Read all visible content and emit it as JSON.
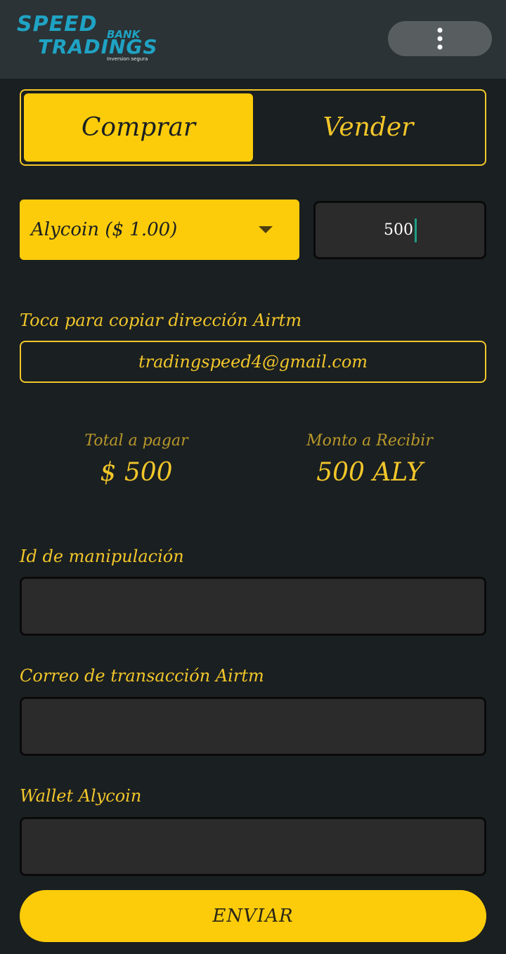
{
  "header": {
    "logo": {
      "speed": "SPEED",
      "bank": "BANK",
      "tradings": "TRADINGS",
      "tagline": "Inversion segura"
    },
    "menu_icon": "more-vertical-icon"
  },
  "toggle": {
    "buy_label": "Comprar",
    "sell_label": "Vender",
    "active": "Comprar"
  },
  "currency_select": {
    "selected": "Alycoin ($ 1.00)",
    "icon": "caret-down-icon"
  },
  "amount_input": {
    "value": "500"
  },
  "copy_address": {
    "label": "Toca para copiar dirección Airtm",
    "value": "tradingspeed4@gmail.com"
  },
  "summary": {
    "total_label": "Total a pagar",
    "total_value": "$ 500",
    "receive_label": "Monto a Recibir",
    "receive_value": "500 ALY"
  },
  "fields": {
    "manipulation_id_label": "Id de manipulación",
    "transaction_email_label": "Correo de transacción Airtm",
    "wallet_label": "Wallet Alycoin"
  },
  "submit_label": "ENVIAR",
  "colors": {
    "accent": "#fccc0a",
    "background": "#1a1f21",
    "header": "#2b3336",
    "logo": "#1fa3c4"
  }
}
